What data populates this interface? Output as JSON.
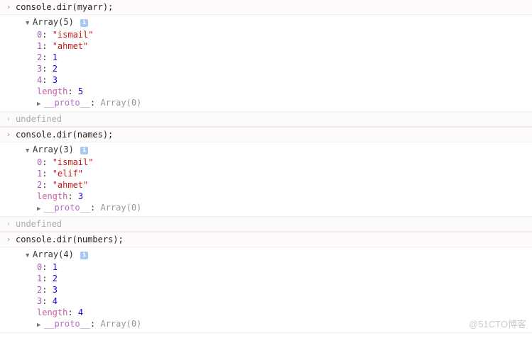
{
  "blocks": [
    {
      "input": "console.dir(myarr);",
      "summary": "Array(5)",
      "entries": [
        {
          "k": "0",
          "kclass": "key-num",
          "v": "\"ismail\"",
          "vclass": "str"
        },
        {
          "k": "1",
          "kclass": "key-num",
          "v": "\"ahmet\"",
          "vclass": "str"
        },
        {
          "k": "2",
          "kclass": "key-num",
          "v": "1",
          "vclass": "num"
        },
        {
          "k": "3",
          "kclass": "key-num",
          "v": "2",
          "vclass": "num"
        },
        {
          "k": "4",
          "kclass": "key-num",
          "v": "3",
          "vclass": "num"
        },
        {
          "k": "length",
          "kclass": "key-length",
          "v": "5",
          "vclass": "num"
        }
      ],
      "proto_label": "__proto__",
      "proto_value": "Array(0)",
      "return": "undefined"
    },
    {
      "input": "console.dir(names);",
      "summary": "Array(3)",
      "entries": [
        {
          "k": "0",
          "kclass": "key-num",
          "v": "\"ismail\"",
          "vclass": "str"
        },
        {
          "k": "1",
          "kclass": "key-num",
          "v": "\"elif\"",
          "vclass": "str"
        },
        {
          "k": "2",
          "kclass": "key-num",
          "v": "\"ahmet\"",
          "vclass": "str"
        },
        {
          "k": "length",
          "kclass": "key-length",
          "v": "3",
          "vclass": "num"
        }
      ],
      "proto_label": "__proto__",
      "proto_value": "Array(0)",
      "return": "undefined"
    },
    {
      "input": "console.dir(numbers);",
      "summary": "Array(4)",
      "entries": [
        {
          "k": "0",
          "kclass": "key-num",
          "v": "1",
          "vclass": "num"
        },
        {
          "k": "1",
          "kclass": "key-num",
          "v": "2",
          "vclass": "num"
        },
        {
          "k": "2",
          "kclass": "key-num",
          "v": "3",
          "vclass": "num"
        },
        {
          "k": "3",
          "kclass": "key-num",
          "v": "4",
          "vclass": "num"
        },
        {
          "k": "length",
          "kclass": "key-length",
          "v": "4",
          "vclass": "num"
        }
      ],
      "proto_label": "__proto__",
      "proto_value": "Array(0)",
      "return": null
    }
  ],
  "glyphs": {
    "input_marker": "›",
    "return_marker": "‹",
    "expanded": "▼",
    "collapsed": "▶",
    "info": "i"
  },
  "watermark": "@51CTO博客"
}
